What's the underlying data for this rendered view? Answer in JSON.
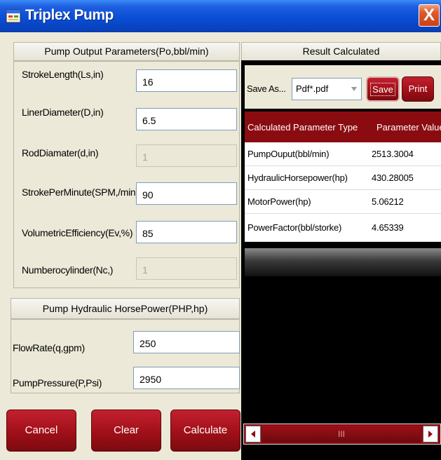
{
  "window": {
    "title": "Triplex Pump",
    "close_glyph": "X",
    "app_icon": "form-icon"
  },
  "pump_output": {
    "header": "Pump Output Parameters(Po,bbl/min)",
    "fields": [
      {
        "label": "StrokeLength(Ls,in)",
        "value": "16",
        "enabled": true
      },
      {
        "label": "LinerDiameter(D,in)",
        "value": "6.5",
        "enabled": true
      },
      {
        "label": "RodDiamater(d,in)",
        "value": "1",
        "enabled": false
      },
      {
        "label": "StrokePerMinute(SPM,/min)",
        "value": "90",
        "enabled": true
      },
      {
        "label": "VolumetricEfficiency(Ev,%)",
        "value": "85",
        "enabled": true
      },
      {
        "label": "Numberocylinder(Nc,)",
        "value": "1",
        "enabled": false
      }
    ]
  },
  "hydraulic": {
    "header": "Pump Hydraulic HorsePower(PHP,hp)",
    "fields": [
      {
        "label": "FlowRate(q,gpm)",
        "value": "250"
      },
      {
        "label": "PumpPressure(P,Psi)",
        "value": "2950"
      }
    ]
  },
  "buttons": {
    "cancel": "Cancel",
    "clear": "Clear",
    "calculate": "Calculate"
  },
  "result": {
    "header": "Result Calculated",
    "save_as_label": "Save As...",
    "format_selected": "Pdf*.pdf",
    "save_label": "Save",
    "print_label": "Print",
    "columns": [
      "Calculated Parameter Type",
      "Parameter Value"
    ],
    "rows": [
      [
        "PumpOuput(bbl/min)",
        "2513.3004"
      ],
      [
        "HydraulicHorsepower(hp)",
        "430.28005"
      ],
      [
        "MotorPower(hp)",
        "5.06212"
      ],
      [
        "PowerFactor(bbl/storke)",
        "4.65339"
      ]
    ],
    "scroll_thumb_glyph": "III"
  },
  "colors": {
    "title_blue": "#0a4ed6",
    "button_red": "#a01018",
    "grid_header": "#8b0c10"
  }
}
